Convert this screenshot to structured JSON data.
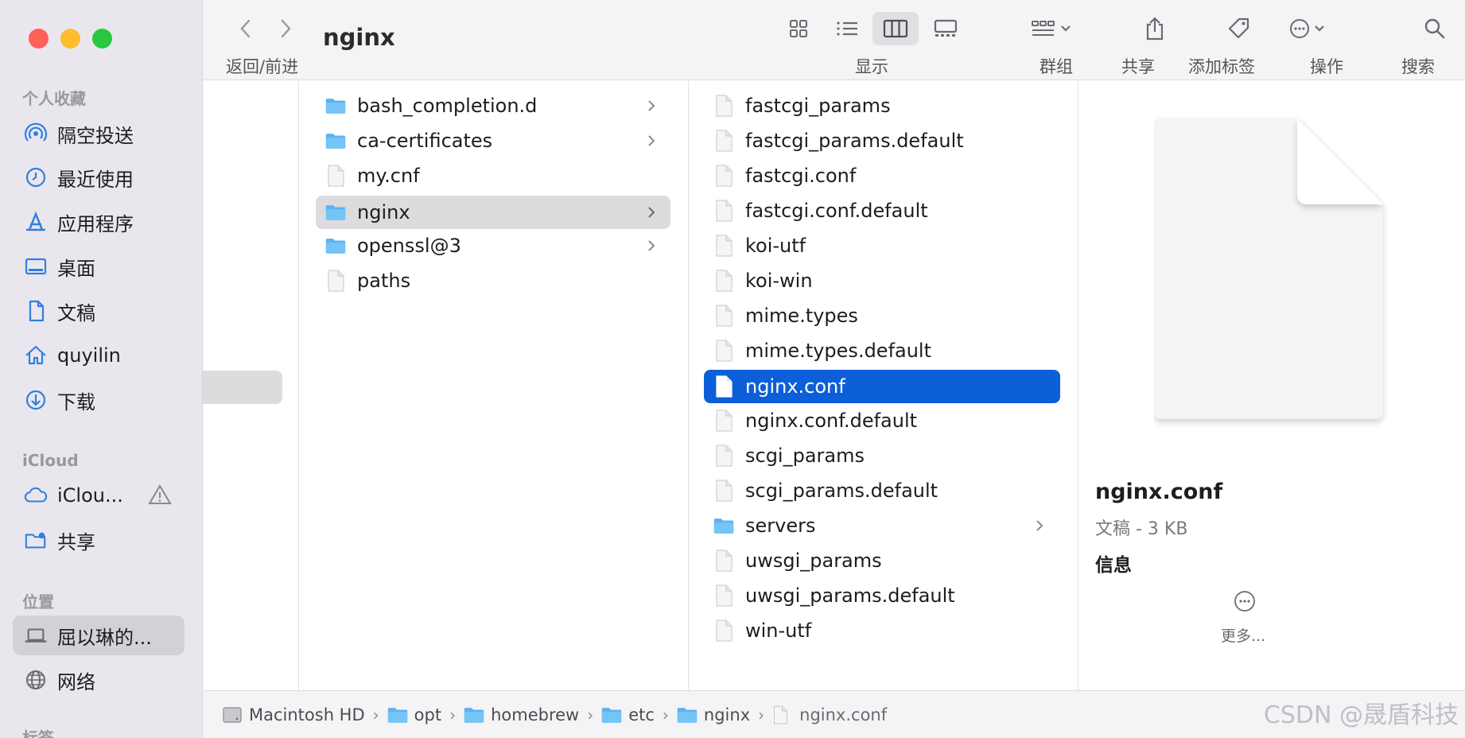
{
  "window": {
    "title": "nginx"
  },
  "toolbar": {
    "back_forward_label": "返回/前进",
    "display_label": "显示",
    "group_label": "群组",
    "share_label": "共享",
    "tag_label": "添加标签",
    "action_label": "操作",
    "search_label": "搜索"
  },
  "sidebar": {
    "favorites_header": "个人收藏",
    "favorites": [
      {
        "label": "隔空投送",
        "icon": "airdrop-icon"
      },
      {
        "label": "最近使用",
        "icon": "clock-icon"
      },
      {
        "label": "应用程序",
        "icon": "applications-icon"
      },
      {
        "label": "桌面",
        "icon": "desktop-icon"
      },
      {
        "label": "文稿",
        "icon": "document-icon"
      },
      {
        "label": "quyilin",
        "icon": "home-icon"
      },
      {
        "label": "下载",
        "icon": "download-icon"
      }
    ],
    "icloud_header": "iCloud",
    "icloud": [
      {
        "label": "iClou...",
        "icon": "cloud-icon"
      },
      {
        "label": "共享",
        "icon": "shared-folder-icon"
      }
    ],
    "locations_header": "位置",
    "locations": [
      {
        "label": "屈以琳的...",
        "icon": "laptop-icon",
        "selected": true
      },
      {
        "label": "网络",
        "icon": "network-icon"
      }
    ],
    "tags_header": "标签"
  },
  "column2": [
    {
      "name": "bash_completion.d",
      "kind": "folder"
    },
    {
      "name": "ca-certificates",
      "kind": "folder"
    },
    {
      "name": "my.cnf",
      "kind": "file"
    },
    {
      "name": "nginx",
      "kind": "folder",
      "selected": true
    },
    {
      "name": "openssl@3",
      "kind": "folder"
    },
    {
      "name": "paths",
      "kind": "file"
    }
  ],
  "column3": [
    {
      "name": "fastcgi_params",
      "kind": "file"
    },
    {
      "name": "fastcgi_params.default",
      "kind": "file"
    },
    {
      "name": "fastcgi.conf",
      "kind": "file"
    },
    {
      "name": "fastcgi.conf.default",
      "kind": "file"
    },
    {
      "name": "koi-utf",
      "kind": "file"
    },
    {
      "name": "koi-win",
      "kind": "file"
    },
    {
      "name": "mime.types",
      "kind": "file"
    },
    {
      "name": "mime.types.default",
      "kind": "file"
    },
    {
      "name": "nginx.conf",
      "kind": "file",
      "selected": true
    },
    {
      "name": "nginx.conf.default",
      "kind": "file"
    },
    {
      "name": "scgi_params",
      "kind": "file"
    },
    {
      "name": "scgi_params.default",
      "kind": "file"
    },
    {
      "name": "servers",
      "kind": "folder"
    },
    {
      "name": "uwsgi_params",
      "kind": "file"
    },
    {
      "name": "uwsgi_params.default",
      "kind": "file"
    },
    {
      "name": "win-utf",
      "kind": "file"
    }
  ],
  "preview": {
    "name": "nginx.conf",
    "meta": "文稿 - 3 KB",
    "info_label": "信息",
    "more_label": "更多..."
  },
  "pathbar": [
    {
      "label": "Macintosh HD",
      "icon": "hard-drive-icon"
    },
    {
      "label": "opt",
      "icon": "folder-icon"
    },
    {
      "label": "homebrew",
      "icon": "folder-icon"
    },
    {
      "label": "etc",
      "icon": "folder-icon"
    },
    {
      "label": "nginx",
      "icon": "folder-icon"
    },
    {
      "label": "nginx.conf",
      "icon": "file-icon"
    }
  ],
  "watermark": "CSDN @晟盾科技",
  "colors": {
    "selection_blue": "#0c5fd9",
    "folder_blue": "#5bb3f0",
    "sidebar_icon_blue": "#2f7fe0"
  }
}
